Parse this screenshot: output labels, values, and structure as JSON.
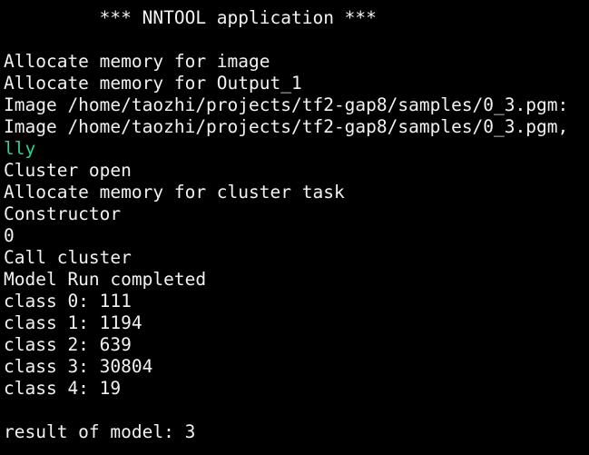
{
  "terminal": {
    "colors": {
      "background": "#000000",
      "text": "#f2f2f2",
      "highlight": "#2fd28a"
    },
    "lines": [
      "         *** NNTOOL application ***",
      "",
      "Allocate memory for image",
      "Allocate memory for Output_1",
      "Image /home/taozhi/projects/tf2-gap8/samples/0_3.pgm:",
      "Image /home/taozhi/projects/tf2-gap8/samples/0_3.pgm,",
      "lly",
      "Cluster open",
      "Allocate memory for cluster task",
      "Constructor",
      "0",
      "Call cluster",
      "Model Run completed",
      "class 0: 111",
      "class 1: 1194",
      "class 2: 639",
      "class 3: 30804",
      "class 4: 19",
      "",
      "result of model: 3"
    ]
  }
}
